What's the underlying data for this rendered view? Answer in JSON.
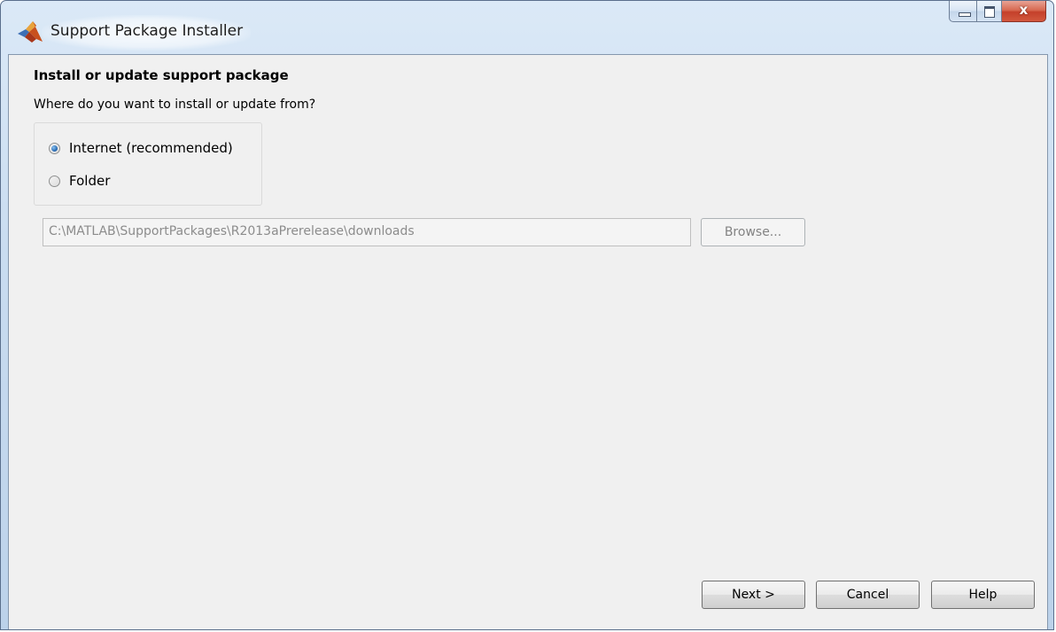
{
  "window": {
    "title": "Support Package Installer",
    "icon": "matlab-logo-icon",
    "controls": {
      "minimize": "minimize-icon",
      "maximize": "maximize-icon",
      "close_glyph": "x"
    }
  },
  "content": {
    "heading": "Install or update support package",
    "question": "Where do you want to install or update from?",
    "options": [
      {
        "label": "Internet (recommended)",
        "selected": true
      },
      {
        "label": "Folder",
        "selected": false
      }
    ],
    "folder_path": "C:\\MATLAB\\SupportPackages\\R2013aPrerelease\\downloads",
    "browse_label": "Browse..."
  },
  "footer": {
    "next_label": "Next >",
    "cancel_label": "Cancel",
    "help_label": "Help"
  },
  "colors": {
    "client_background": "#f0f0f0",
    "titlebar": "#c9dcf0",
    "close_button": "#c4402a",
    "radio_selected": "#2a6db5"
  }
}
